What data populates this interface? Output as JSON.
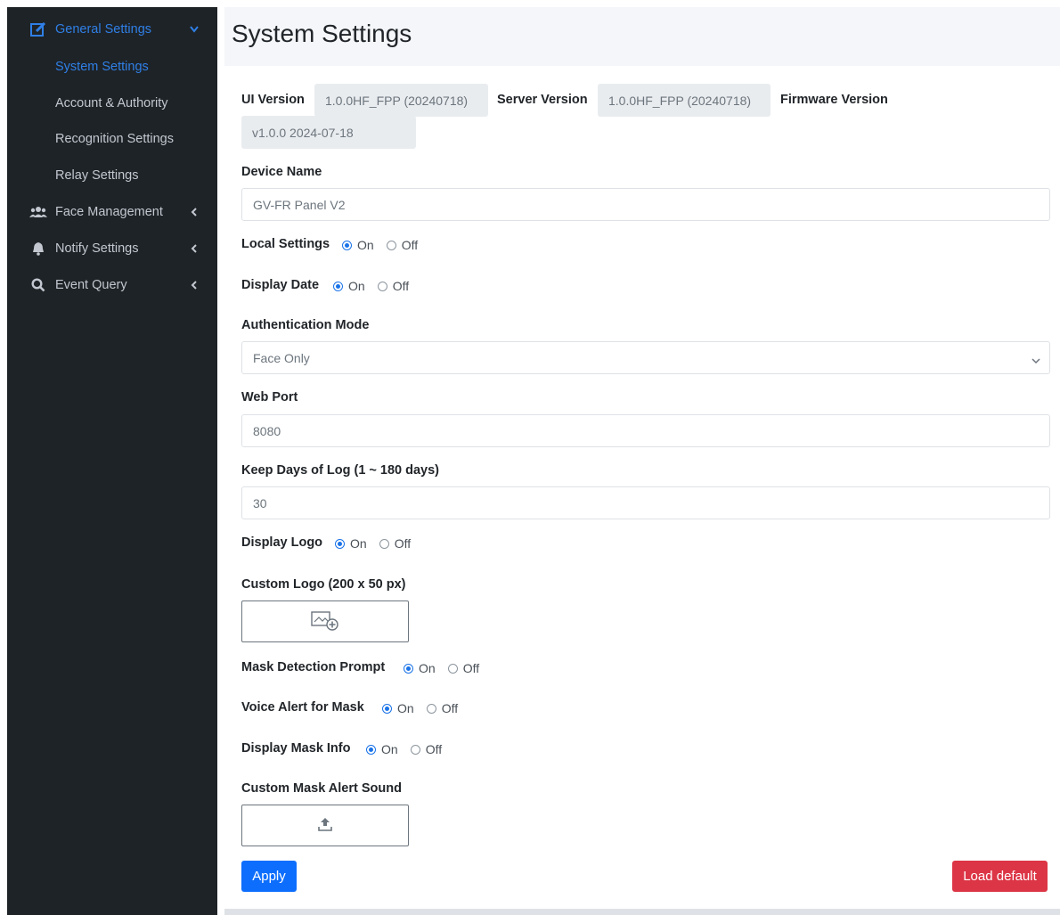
{
  "sidebar": {
    "general_settings": "General Settings",
    "sub_items": [
      "System Settings",
      "Account & Authority",
      "Recognition Settings",
      "Relay Settings"
    ],
    "face_management": "Face Management",
    "notify_settings": "Notify Settings",
    "event_query": "Event Query"
  },
  "page": {
    "title": "System Settings"
  },
  "versions": {
    "ui_label": "UI Version",
    "ui_value": "1.0.0HF_FPP (20240718)",
    "server_label": "Server Version",
    "server_value": "1.0.0HF_FPP (20240718)",
    "firmware_label": "Firmware Version",
    "firmware_value": "v1.0.0 2024-07-18"
  },
  "form": {
    "device_name_label": "Device Name",
    "device_name_value": "GV-FR Panel V2",
    "local_settings_label": "Local Settings",
    "display_date_label": "Display Date",
    "auth_mode_label": "Authentication Mode",
    "auth_mode_value": "Face Only",
    "web_port_label": "Web Port",
    "web_port_value": "8080",
    "keep_days_label": "Keep Days of Log (1 ~ 180 days)",
    "keep_days_value": "30",
    "display_logo_label": "Display Logo",
    "custom_logo_label": "Custom Logo (200 x 50 px)",
    "mask_prompt_label": "Mask Detection Prompt",
    "voice_alert_label": "Voice Alert for Mask",
    "display_mask_label": "Display Mask Info",
    "custom_sound_label": "Custom Mask Alert Sound",
    "on_label": "On",
    "off_label": "Off"
  },
  "buttons": {
    "apply": "Apply",
    "load_default": "Load default"
  },
  "colors": {
    "sidebar_bg": "#1e2327",
    "active": "#2f7fe6",
    "primary": "#0d6efd",
    "danger": "#dc3545"
  },
  "icons": [
    "edit-icon",
    "chevron-down-icon",
    "users-icon",
    "bell-icon",
    "search-icon",
    "chevron-left-icon",
    "image-add-icon",
    "upload-icon"
  ]
}
